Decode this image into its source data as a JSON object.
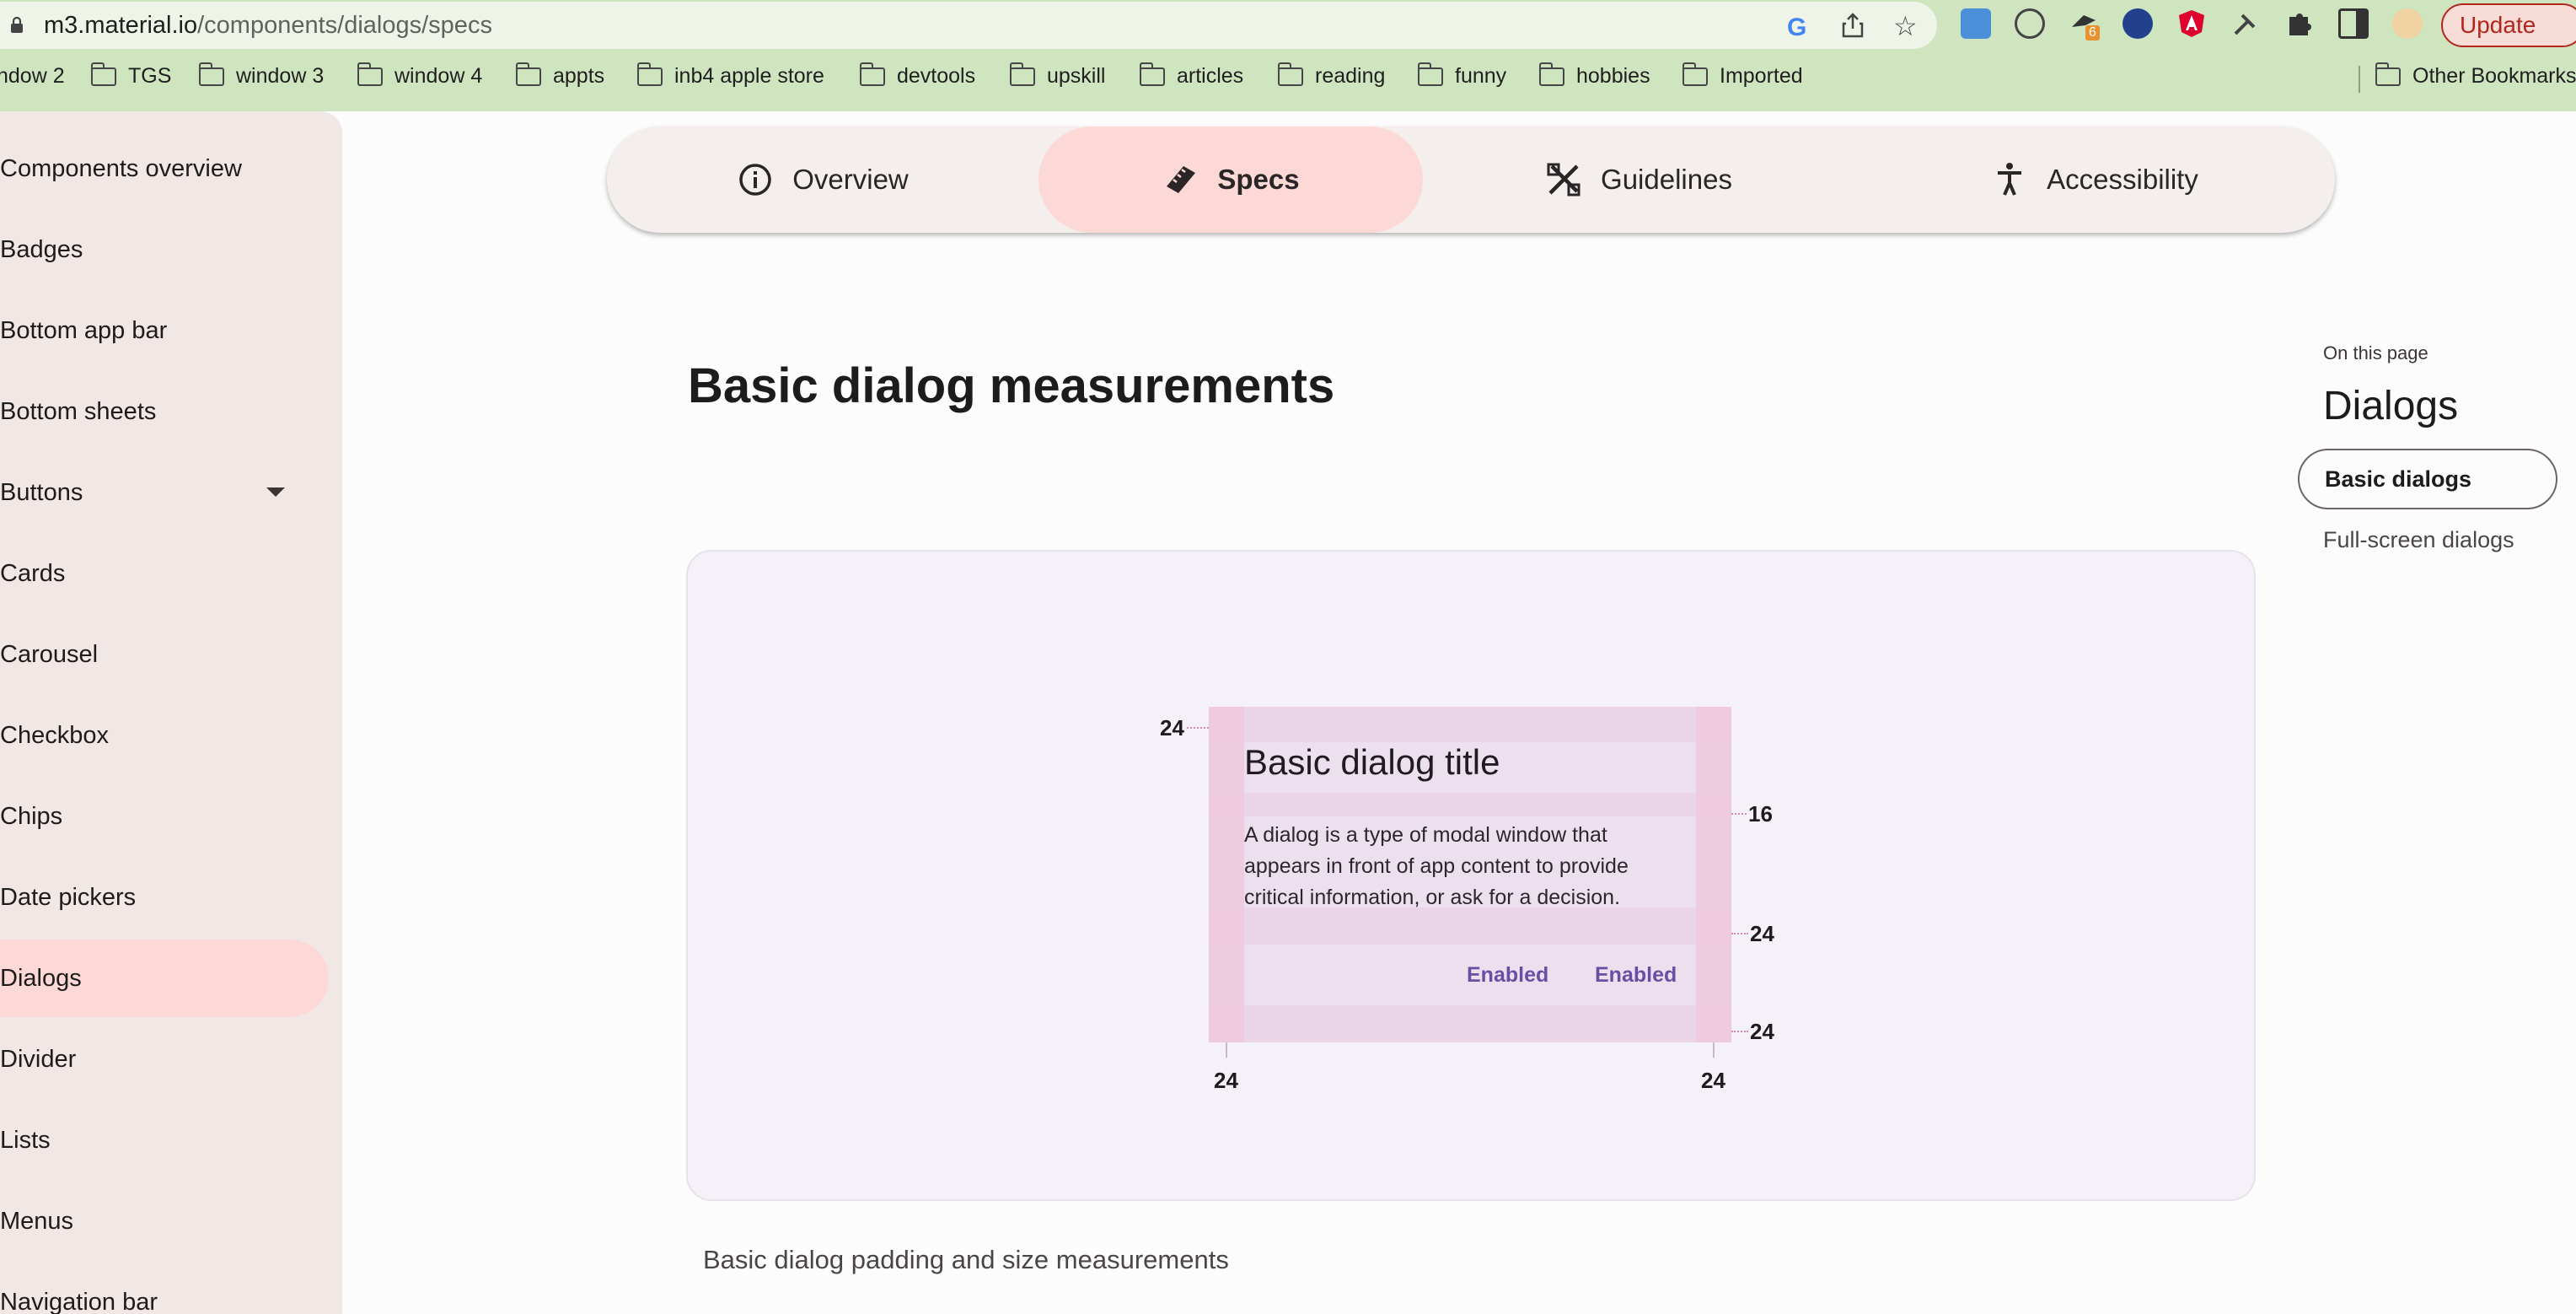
{
  "browser": {
    "url_host": "m3.material.io",
    "url_path": "/components/dialogs/specs",
    "update_label": "Update",
    "extension_badge": "6",
    "bookmarks": [
      "ndow 2",
      "TGS",
      "window 3",
      "window 4",
      "appts",
      "inb4 apple store",
      "devtools",
      "upskill",
      "articles",
      "reading",
      "funny",
      "hobbies",
      "Imported"
    ],
    "other_bookmarks": "Other Bookmarks"
  },
  "sidebar": {
    "items": [
      {
        "label": "Components overview"
      },
      {
        "label": "Badges"
      },
      {
        "label": "Bottom app bar"
      },
      {
        "label": "Bottom sheets"
      },
      {
        "label": "Buttons",
        "expandable": true
      },
      {
        "label": "Cards"
      },
      {
        "label": "Carousel"
      },
      {
        "label": "Checkbox"
      },
      {
        "label": "Chips"
      },
      {
        "label": "Date pickers"
      },
      {
        "label": "Dialogs",
        "active": true
      },
      {
        "label": "Divider"
      },
      {
        "label": "Lists"
      },
      {
        "label": "Menus"
      },
      {
        "label": "Navigation bar"
      }
    ]
  },
  "tabs": [
    {
      "label": "Overview",
      "icon": "info-icon"
    },
    {
      "label": "Specs",
      "icon": "ruler-icon",
      "active": true
    },
    {
      "label": "Guidelines",
      "icon": "tools-icon"
    },
    {
      "label": "Accessibility",
      "icon": "accessibility-icon"
    }
  ],
  "main": {
    "title": "Basic dialog measurements",
    "caption": "Basic dialog padding and size measurements",
    "dialog": {
      "title": "Basic dialog title",
      "body": "A dialog is a type of modal window that appears in front of app content to provide critical information, or ask for a decision.",
      "button1": "Enabled",
      "button2": "Enabled"
    },
    "measurements": {
      "top": "24",
      "title_gap": "16",
      "body_gap": "24",
      "bottom": "24",
      "left": "24",
      "right": "24"
    }
  },
  "toc": {
    "label": "On this page",
    "title": "Dialogs",
    "items": [
      {
        "label": "Basic dialogs",
        "active": true
      },
      {
        "label": "Full-screen dialogs"
      }
    ]
  },
  "colors": {
    "accent_pink": "#fcd9d6",
    "chrome_green": "#cfe5c0",
    "dialog_button": "#6750a4"
  }
}
